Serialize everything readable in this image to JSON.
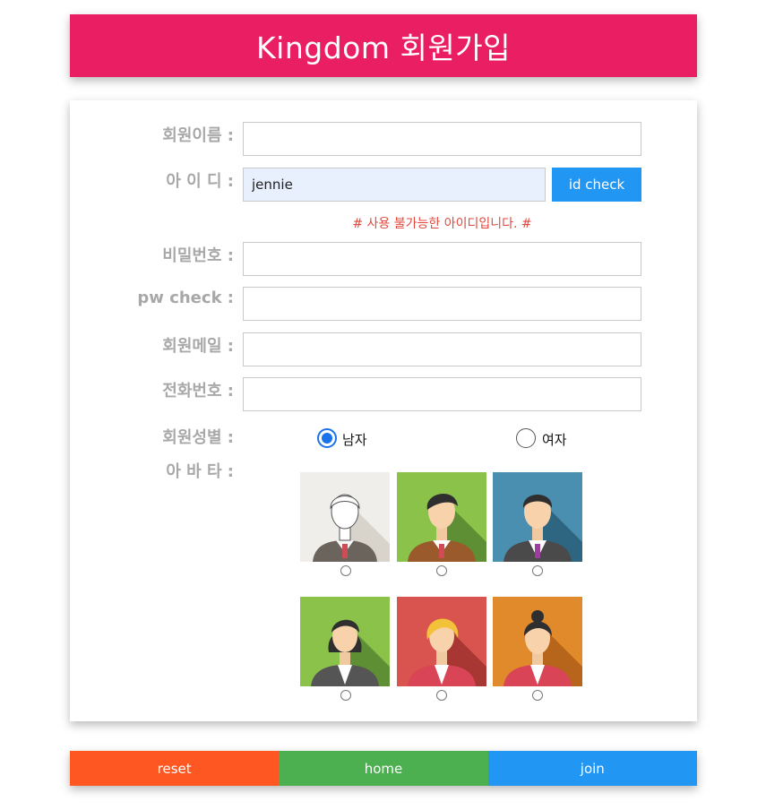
{
  "header": {
    "title": "Kingdom 회원가입"
  },
  "form": {
    "name_label": "회원이름 :",
    "name_value": "",
    "id_label": "아 이 디 :",
    "id_value": "jennie",
    "id_check_label": "id check",
    "id_message": "# 사용 불가능한 아이디입니다. #",
    "pw_label": "비밀번호 :",
    "pw_check_label": "pw check :",
    "email_label": "회원메일 :",
    "phone_label": "전화번호 :",
    "gender_label": "회원성별 :",
    "gender_options": [
      {
        "label": "남자",
        "selected": true
      },
      {
        "label": "여자",
        "selected": false
      }
    ],
    "avatar_label": "아 바 타 :",
    "avatars": [
      {
        "icon": "avatar-outline-man-icon",
        "bg": "#f0eeea"
      },
      {
        "icon": "avatar-man-sweater-icon",
        "bg": "#8bc34a"
      },
      {
        "icon": "avatar-man-suit-icon",
        "bg": "#4a8fb0"
      },
      {
        "icon": "avatar-woman-dark-icon",
        "bg": "#8bc34a"
      },
      {
        "icon": "avatar-woman-blonde-icon",
        "bg": "#d9534f"
      },
      {
        "icon": "avatar-woman-orange-icon",
        "bg": "#e08a2c"
      }
    ]
  },
  "footer": {
    "reset_label": "reset",
    "home_label": "home",
    "join_label": "join",
    "colors": {
      "reset": "#ff5722",
      "home": "#4caf50",
      "join": "#2196f3"
    }
  },
  "colors": {
    "header": "#e91e63",
    "accent": "#2196f3",
    "error": "#e0483d"
  }
}
